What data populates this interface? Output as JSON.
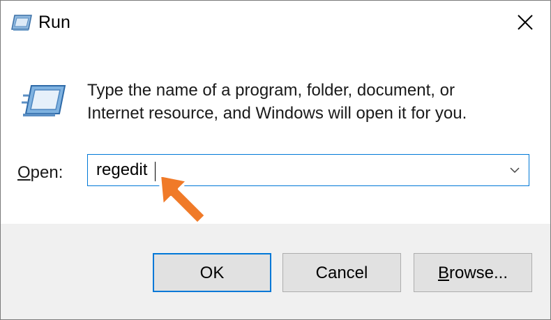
{
  "window": {
    "title": "Run",
    "close_icon": "close-icon"
  },
  "dialog": {
    "description_line1": "Type the name of a program, folder, document, or",
    "description_line2": "Internet resource, and Windows will open it for you.",
    "open_label_mnemonic": "O",
    "open_label_rest": "pen:",
    "open_value": "regedit",
    "icon": "run-icon"
  },
  "buttons": {
    "ok": "OK",
    "cancel": "Cancel",
    "browse_mnemonic": "B",
    "browse_rest": "rowse..."
  },
  "colors": {
    "accent": "#0078d7",
    "footer_bg": "#f0f0f0",
    "pointer_arrow": "#f07a28",
    "watermark": "#e8e8e8"
  }
}
